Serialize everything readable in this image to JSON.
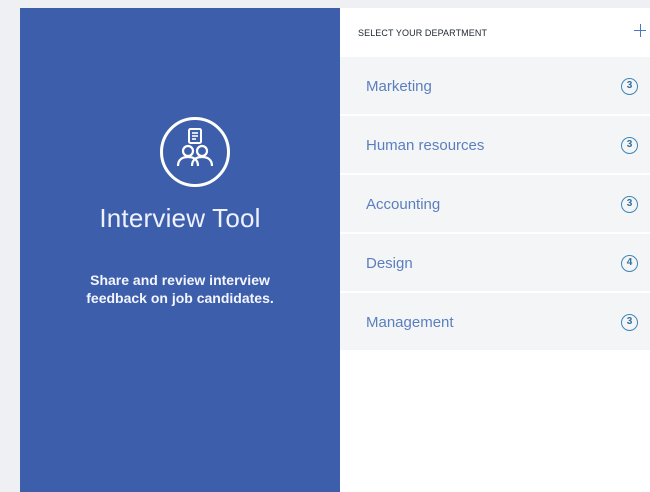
{
  "app": {
    "title": "Interview Tool",
    "description": "Share and review interview feedback on job candidates.",
    "logo_icon": "interview-people-icon"
  },
  "departments": {
    "header": "SELECT YOUR DEPARTMENT",
    "add_icon": "plus-icon",
    "items": [
      {
        "name": "Marketing",
        "count": "3"
      },
      {
        "name": "Human resources",
        "count": "3"
      },
      {
        "name": "Accounting",
        "count": "3"
      },
      {
        "name": "Design",
        "count": "4"
      },
      {
        "name": "Management",
        "count": "3"
      }
    ]
  },
  "colors": {
    "brand_blue": "#3d5fab",
    "link_blue": "#5b7fbe",
    "badge_blue": "#3e86b5",
    "row_background": "#f4f5f7"
  }
}
